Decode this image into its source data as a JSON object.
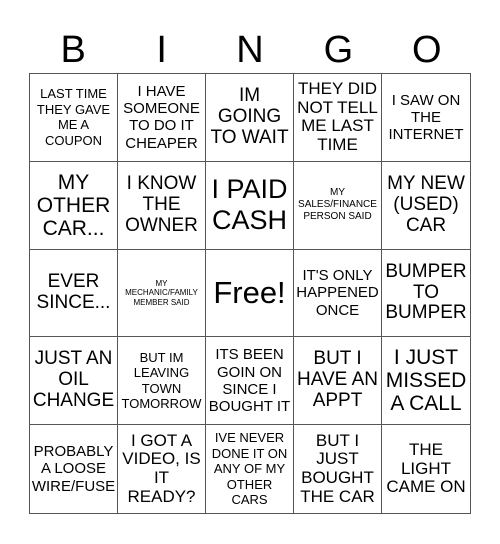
{
  "header": {
    "letters": [
      "B",
      "I",
      "N",
      "G",
      "O"
    ]
  },
  "cells": [
    "LAST TIME THEY GAVE ME A COUPON",
    "I HAVE SOMEONE TO DO IT CHEAPER",
    "IM GOING TO WAIT",
    "THEY DID NOT TELL ME LAST TIME",
    "I SAW ON THE INTERNET",
    "MY OTHER CAR...",
    "I KNOW THE OWNER",
    "I PAID CASH",
    "MY SALES/FINANCE PERSON SAID",
    "MY NEW (USED) CAR",
    "EVER SINCE...",
    "MY MECHANIC/FAMILY MEMBER SAID",
    "Free!",
    "IT'S ONLY HAPPENED ONCE",
    "BUMPER TO BUMPER",
    "JUST AN OIL CHANGE",
    "BUT IM LEAVING TOWN TOMORROW",
    "ITS BEEN GOIN ON SINCE I BOUGHT IT",
    "BUT I HAVE AN APPT",
    "I JUST MISSED A CALL",
    "PROBABLY A LOOSE WIRE/FUSE",
    "I GOT A VIDEO, IS IT READY?",
    "IVE NEVER DONE IT ON ANY OF MY OTHER CARS",
    "BUT I JUST BOUGHT THE CAR",
    "THE LIGHT CAME ON"
  ]
}
